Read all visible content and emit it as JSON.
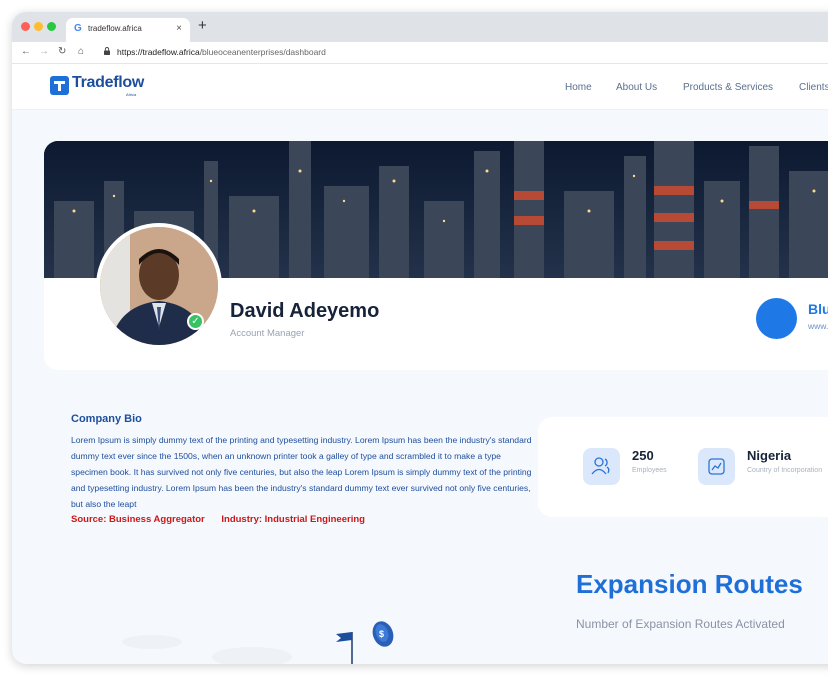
{
  "browser": {
    "tab_favicon": "G",
    "tab_title": "tradeflow.africa",
    "tab_close": "×",
    "new_tab": "+",
    "url_host": "https://tradeflow.africa",
    "url_path": "/blueoceanenterprises/dashboard"
  },
  "header": {
    "logo_text": "Tradeflow",
    "logo_sub": "Africa",
    "nav": [
      "Home",
      "About Us",
      "Products & Services",
      "Clients"
    ]
  },
  "profile": {
    "name": "David Adeyemo",
    "role": "Account Manager",
    "company_name": "Blue Ocean Enterprises",
    "company_url": "www.blueoceanenterprises.com"
  },
  "bio": {
    "title": "Company Bio",
    "text": "Lorem Ipsum is simply dummy text of the printing and typesetting industry. Lorem Ipsum has been the industry's standard dummy text ever since the 1500s, when an unknown printer took a galley of type and scrambled it to make a type specimen book. It has survived not only five centuries, but also the leap Lorem Ipsum is simply dummy text of the printing and typesetting industry. Lorem Ipsum has been the industry's standard dummy text ever survived not only five centuries, but also the leapt",
    "source": "Source: Business Aggregator",
    "industry": "Industry: Industrial Engineering"
  },
  "stats": {
    "employees_value": "250",
    "employees_label": "Employees",
    "country_value": "Nigeria",
    "country_label": "Country of Incorporation"
  },
  "expansion": {
    "title": "Expansion Routes",
    "subtitle": "Number of Expansion Routes Activated"
  },
  "colors": {
    "brand_blue": "#1f6fd9",
    "source_red": "#cc1818",
    "verified_green": "#38c263"
  },
  "icons": [
    "back-icon",
    "forward-icon",
    "reload-icon",
    "home-icon",
    "lock-icon",
    "people-icon",
    "chart-icon",
    "verified-icon",
    "flag-icon",
    "coin-icon"
  ]
}
